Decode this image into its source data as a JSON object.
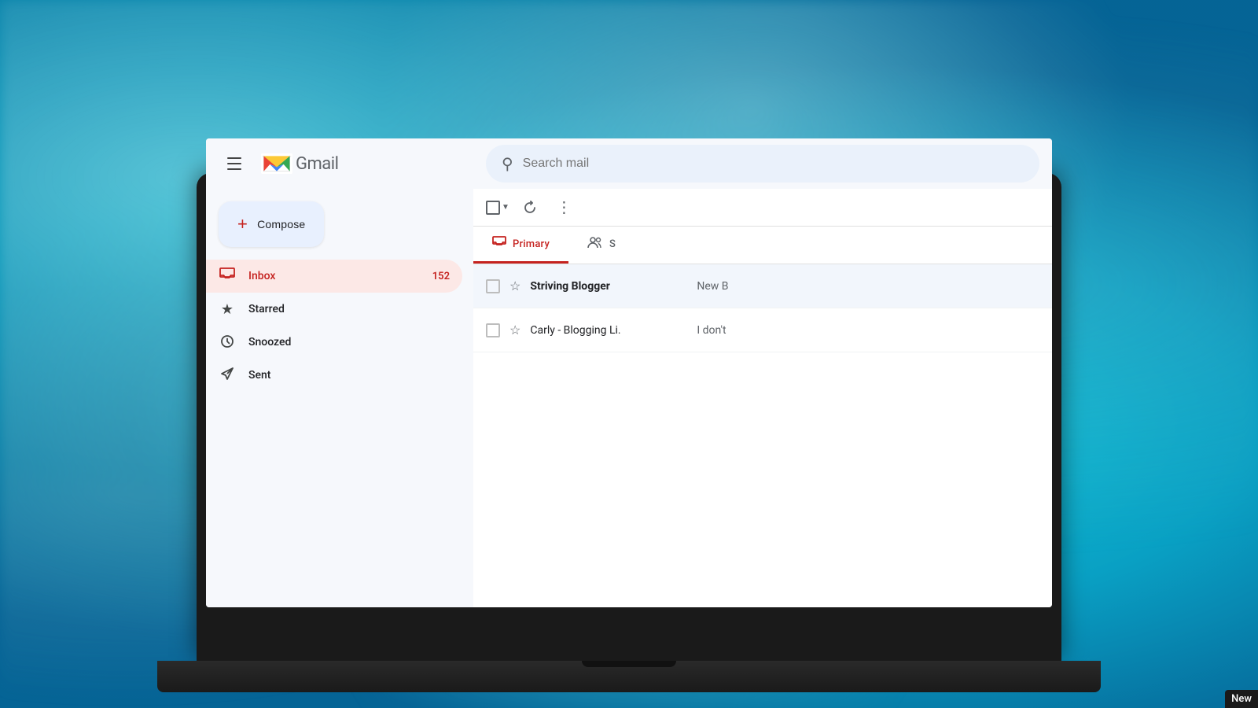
{
  "background": {
    "alt": "Blurred watery teal background"
  },
  "header": {
    "menu_label": "Menu",
    "logo_text": "Gmail",
    "search_placeholder": "Search mail"
  },
  "sidebar": {
    "compose_label": "Compose",
    "nav_items": [
      {
        "id": "inbox",
        "label": "Inbox",
        "icon": "inbox",
        "count": "152",
        "active": true
      },
      {
        "id": "starred",
        "label": "Starred",
        "icon": "star",
        "count": "",
        "active": false
      },
      {
        "id": "snoozed",
        "label": "Snoozed",
        "icon": "clock",
        "count": "",
        "active": false
      },
      {
        "id": "sent",
        "label": "Sent",
        "icon": "send",
        "count": "",
        "active": false
      }
    ]
  },
  "toolbar": {
    "select_all_label": "Select all",
    "refresh_label": "Refresh",
    "more_label": "More"
  },
  "tabs": [
    {
      "id": "primary",
      "label": "Primary",
      "icon": "inbox",
      "active": true
    },
    {
      "id": "social",
      "label": "S",
      "icon": "people",
      "active": false
    }
  ],
  "emails": [
    {
      "sender": "Striving Blogger",
      "preview": "New B",
      "starred": false,
      "unread": true
    },
    {
      "sender": "Carly - Blogging Li.",
      "preview": "I don't",
      "starred": false,
      "unread": false
    }
  ],
  "new_badge": {
    "label": "New"
  }
}
